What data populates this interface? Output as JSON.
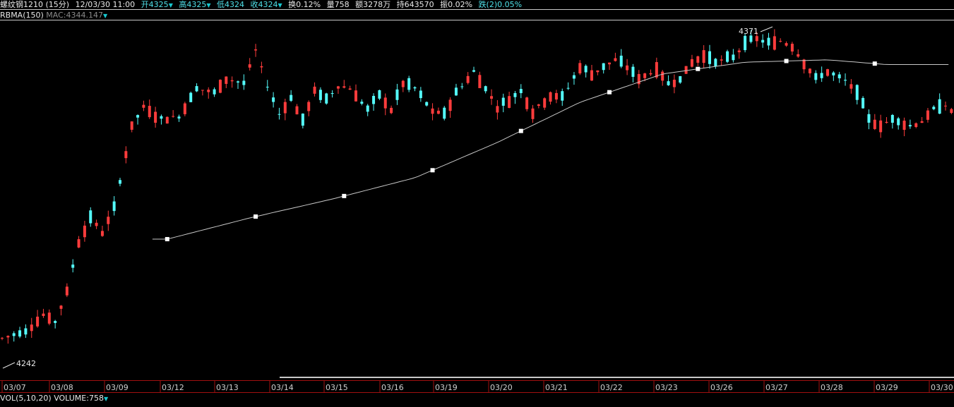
{
  "header": {
    "instrument": "螺纹钢1210 (15分)",
    "datetime": "12/03/30 11:00",
    "open": "开4325",
    "high": "高4325",
    "low": "低4324",
    "close": "收4324",
    "turnover": "换0.12%",
    "volume": "量758",
    "amount": "额3278万",
    "open_interest": "持643570",
    "amplitude": "振0.02%",
    "change": "跌(2)0.05%",
    "down_arrow": "▼"
  },
  "indicator": {
    "name": "RBMA(150)",
    "value": "MAC:4344.147"
  },
  "volume_panel": {
    "label": "VOL(5,10,20)",
    "value": "VOLUME:758"
  },
  "colors": {
    "up": "#ff3c3c",
    "down": "#54fcfc",
    "ma": "#c8c8c8",
    "axis": "#a01010",
    "background": "#000000"
  },
  "chart_data": {
    "type": "candlestick",
    "y_range": [
      4230,
      4375
    ],
    "annotations": {
      "high": "4371",
      "low": "4242"
    },
    "x_tick_labels": [
      "03/07",
      "03/08",
      "03/09",
      "03/12",
      "03/13",
      "03/14",
      "03/15",
      "03/16",
      "03/19",
      "03/20",
      "03/21",
      "03/22",
      "03/23",
      "03/26",
      "03/27",
      "03/28",
      "03/29",
      "03/30"
    ],
    "ohlc_anchors": [
      [
        0,
        4243
      ],
      [
        4,
        4246
      ],
      [
        7,
        4253
      ],
      [
        9,
        4250
      ],
      [
        11,
        4263
      ],
      [
        13,
        4284
      ],
      [
        15,
        4294
      ],
      [
        17,
        4288
      ],
      [
        19,
        4298
      ],
      [
        22,
        4333
      ],
      [
        24,
        4341
      ],
      [
        27,
        4336
      ],
      [
        30,
        4337
      ],
      [
        33,
        4349
      ],
      [
        36,
        4347
      ],
      [
        38,
        4353
      ],
      [
        41,
        4351
      ],
      [
        43,
        4365
      ],
      [
        45,
        4350
      ],
      [
        47,
        4338
      ],
      [
        49,
        4345
      ],
      [
        51,
        4335
      ],
      [
        53,
        4348
      ],
      [
        55,
        4344
      ],
      [
        57,
        4350
      ],
      [
        59,
        4349
      ],
      [
        62,
        4340
      ],
      [
        64,
        4346
      ],
      [
        66,
        4340
      ],
      [
        68,
        4351
      ],
      [
        70,
        4349
      ],
      [
        73,
        4339
      ],
      [
        75,
        4338
      ],
      [
        77,
        4347
      ],
      [
        80,
        4356
      ],
      [
        82,
        4349
      ],
      [
        84,
        4341
      ],
      [
        86,
        4344
      ],
      [
        88,
        4348
      ],
      [
        90,
        4339
      ],
      [
        93,
        4346
      ],
      [
        95,
        4345
      ],
      [
        98,
        4358
      ],
      [
        100,
        4355
      ],
      [
        102,
        4358
      ],
      [
        104,
        4361
      ],
      [
        106,
        4358
      ],
      [
        108,
        4353
      ],
      [
        111,
        4357
      ],
      [
        113,
        4351
      ],
      [
        115,
        4353
      ],
      [
        117,
        4360
      ],
      [
        119,
        4363
      ],
      [
        121,
        4360
      ],
      [
        124,
        4362
      ],
      [
        126,
        4368
      ],
      [
        128,
        4370
      ],
      [
        130,
        4368
      ],
      [
        132,
        4369
      ],
      [
        134,
        4367
      ],
      [
        136,
        4360
      ],
      [
        138,
        4353
      ],
      [
        140,
        4356
      ],
      [
        143,
        4352
      ],
      [
        145,
        4347
      ],
      [
        147,
        4336
      ],
      [
        149,
        4333
      ],
      [
        151,
        4336
      ],
      [
        154,
        4333
      ],
      [
        156,
        4335
      ],
      [
        158,
        4340
      ],
      [
        160,
        4342
      ],
      [
        161,
        4339
      ]
    ],
    "ma_anchors": [
      [
        28,
        4285
      ],
      [
        42,
        4294
      ],
      [
        56,
        4302
      ],
      [
        70,
        4311
      ],
      [
        84,
        4326
      ],
      [
        98,
        4343
      ],
      [
        112,
        4355
      ],
      [
        126,
        4360
      ],
      [
        140,
        4361
      ],
      [
        150,
        4359
      ]
    ],
    "ma_start_index": 28,
    "candle_count": 162
  }
}
